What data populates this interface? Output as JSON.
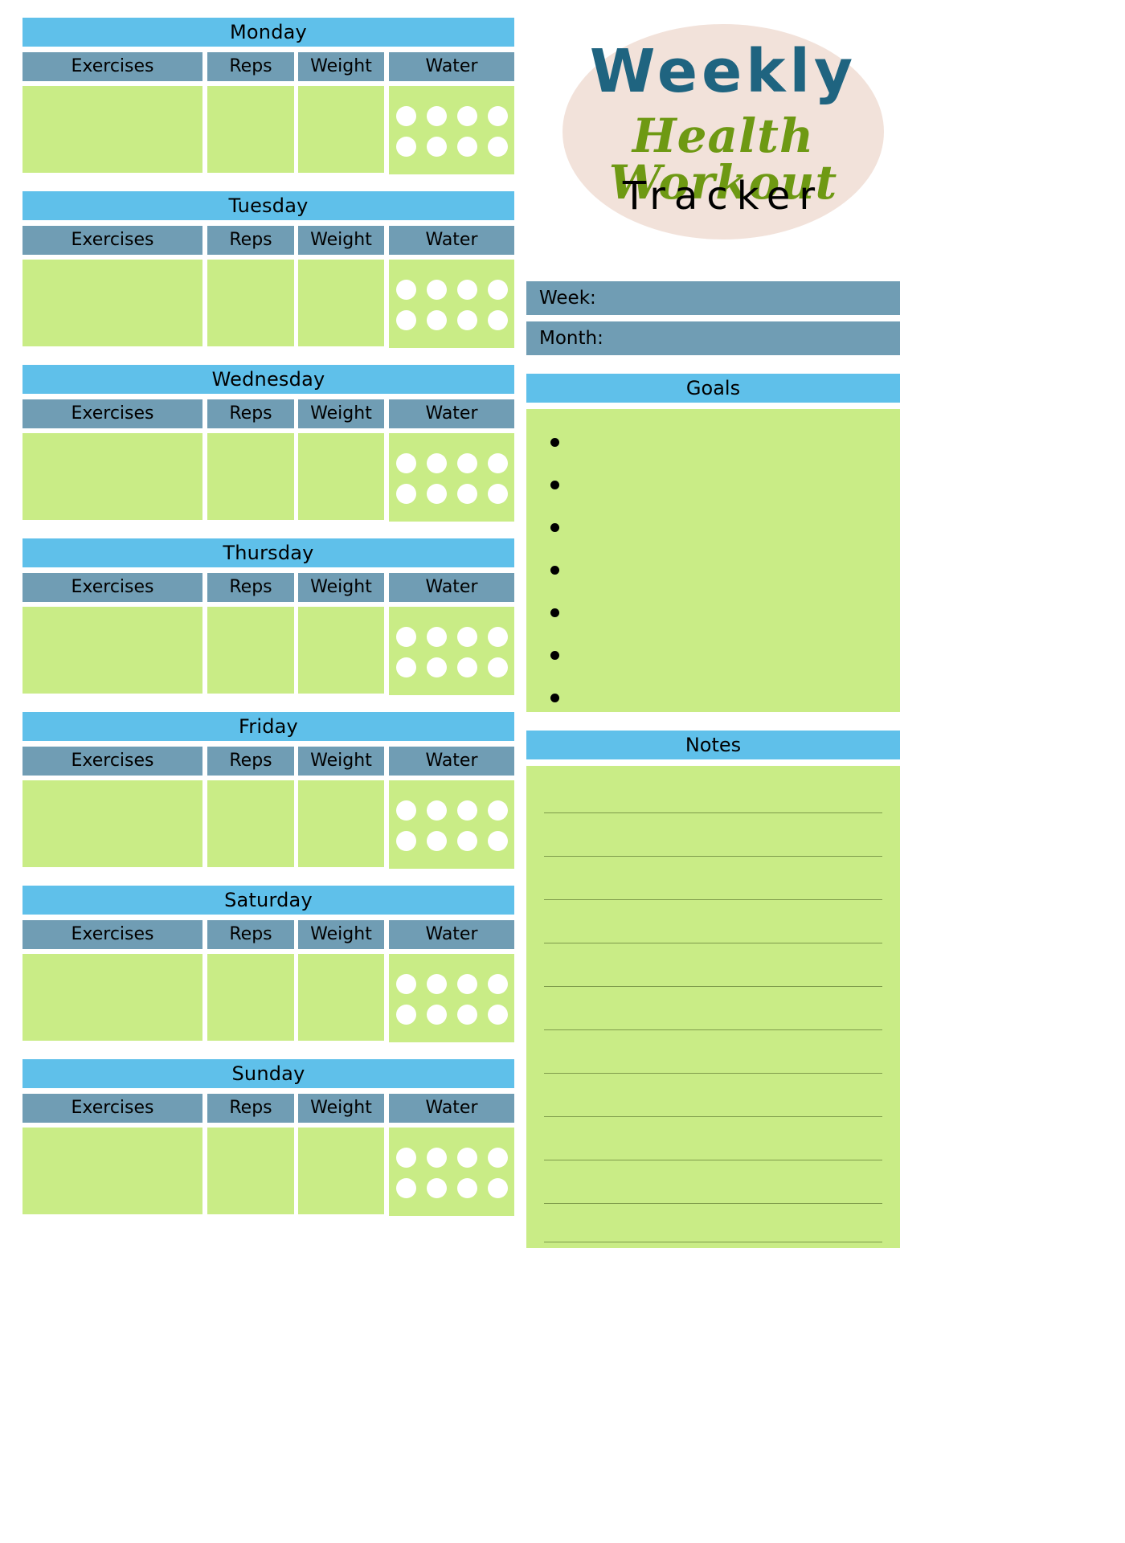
{
  "title": {
    "line1": "Weekly",
    "line2": "Health Workout",
    "line3": "Tracker",
    "ellipse_color": "#F2E2DA",
    "line1_color": "#1F6480",
    "line2_color": "#6E9913",
    "line3_color": "#000000"
  },
  "palette": {
    "day_header_blue": "#5FC0EA",
    "column_header_slate": "#709DB4",
    "cell_green": "#C9EC86",
    "note_rule": "#7E9B4B",
    "water_drop": "#FFFFFF"
  },
  "columns": {
    "exercises": "Exercises",
    "reps": "Reps",
    "weight": "Weight",
    "water": "Water"
  },
  "water": {
    "cols": 4,
    "rows": 2,
    "total": 8
  },
  "days": [
    {
      "name": "Monday",
      "exercises": "",
      "reps": "",
      "weight": "",
      "water_filled": 0
    },
    {
      "name": "Tuesday",
      "exercises": "",
      "reps": "",
      "weight": "",
      "water_filled": 0
    },
    {
      "name": "Wednesday",
      "exercises": "",
      "reps": "",
      "weight": "",
      "water_filled": 0
    },
    {
      "name": "Thursday",
      "exercises": "",
      "reps": "",
      "weight": "",
      "water_filled": 0
    },
    {
      "name": "Friday",
      "exercises": "",
      "reps": "",
      "weight": "",
      "water_filled": 0
    },
    {
      "name": "Saturday",
      "exercises": "",
      "reps": "",
      "weight": "",
      "water_filled": 0
    },
    {
      "name": "Sunday",
      "exercises": "",
      "reps": "",
      "weight": "",
      "water_filled": 0
    }
  ],
  "fields": {
    "week_label": "Week:",
    "week_value": "",
    "month_label": "Month:",
    "month_value": ""
  },
  "goals": {
    "header": "Goals",
    "items": [
      "",
      "",
      "",
      "",
      "",
      "",
      ""
    ],
    "bullet_count": 7
  },
  "notes": {
    "header": "Notes",
    "line_count": 11,
    "lines": [
      "",
      "",
      "",
      "",
      "",
      "",
      "",
      "",
      "",
      "",
      ""
    ]
  }
}
